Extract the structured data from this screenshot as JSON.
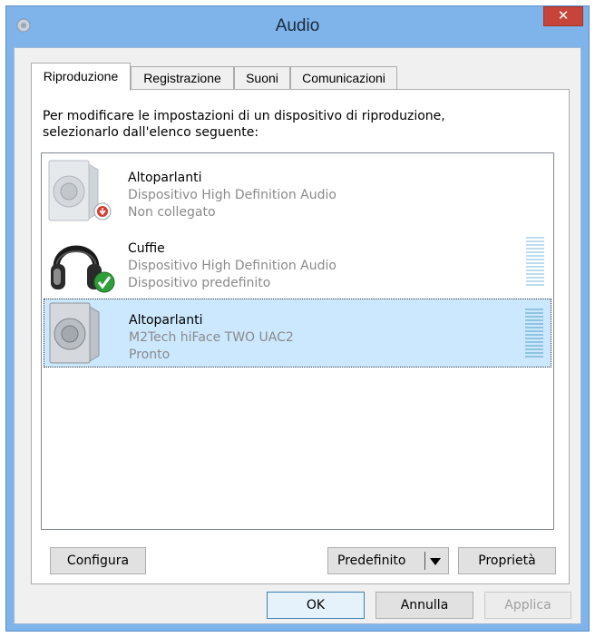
{
  "window": {
    "title": "Audio",
    "close_glyph": "✕"
  },
  "tabs": [
    {
      "label": "Riproduzione",
      "active": true
    },
    {
      "label": "Registrazione",
      "active": false
    },
    {
      "label": "Suoni",
      "active": false
    },
    {
      "label": "Comunicazioni",
      "active": false
    }
  ],
  "panel": {
    "description_line1": "Per modificare le impostazioni di un dispositivo di riproduzione,",
    "description_line2": "selezionarlo dall'elenco seguente:"
  },
  "devices": [
    {
      "name": "Altoparlanti",
      "line1": "Dispositivo High Definition Audio",
      "line2": "Non collegato",
      "icon": "speaker-icon",
      "badge": "unplugged-badge-icon",
      "selected": false
    },
    {
      "name": "Cuffie",
      "line1": "Dispositivo High Definition Audio",
      "line2": "Dispositivo predefinito",
      "icon": "headphones-icon",
      "badge": "default-check-badge-icon",
      "selected": false
    },
    {
      "name": "Altoparlanti",
      "line1": "M2Tech hiFace TWO UAC2",
      "line2": "Pronto",
      "icon": "speaker-icon",
      "badge": "",
      "selected": true
    }
  ],
  "buttons": {
    "configure": "Configura",
    "set_default": "Predefinito",
    "properties": "Proprietà",
    "ok": "OK",
    "cancel": "Annulla",
    "apply": "Applica"
  },
  "colors": {
    "selection": "#cce8ff",
    "titlebar": "#7eb4ea",
    "close": "#c7443a",
    "meter": "#bcdcee"
  }
}
